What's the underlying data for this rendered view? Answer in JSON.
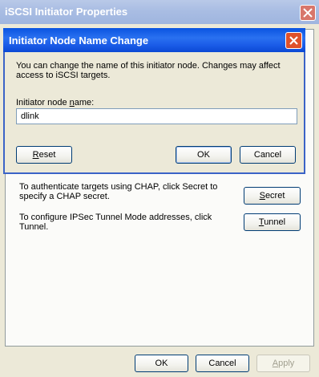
{
  "parent_window": {
    "title": "iSCSI Initiator Properties",
    "chap_text": "To authenticate targets using CHAP, click Secret to specify a CHAP secret.",
    "secret_label_pre": "",
    "secret_label_ul": "S",
    "secret_label_post": "ecret",
    "ipsec_text": "To configure IPSec Tunnel Mode addresses, click Tunnel.",
    "tunnel_label_pre": "",
    "tunnel_label_ul": "T",
    "tunnel_label_post": "unnel",
    "ok_label": "OK",
    "cancel_label": "Cancel",
    "apply_label_pre": "",
    "apply_label_ul": "A",
    "apply_label_post": "pply"
  },
  "dialog": {
    "title": "Initiator Node Name Change",
    "description": "You can change the name of this initiator node.  Changes may affect access to iSCSI targets.",
    "field_label_pre": "Initiator node ",
    "field_label_ul": "n",
    "field_label_post": "ame:",
    "field_value": "dlink",
    "reset_label_pre": "",
    "reset_label_ul": "R",
    "reset_label_post": "eset",
    "ok_label": "OK",
    "cancel_label": "Cancel"
  },
  "icons": {
    "close": "close-icon"
  },
  "colors": {
    "dialog_title_bar": "#1b5ce8",
    "parent_title_bar": "#a9bde3",
    "close_button": "#e0512a",
    "window_face": "#ece9d8"
  }
}
